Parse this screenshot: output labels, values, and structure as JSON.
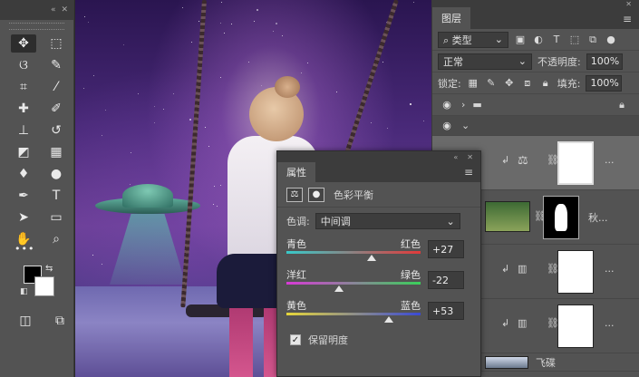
{
  "toolbar": {
    "collapse_label": "«",
    "close_label": "✕",
    "tools": [
      {
        "name": "move-tool",
        "glyph": "✥",
        "active": true
      },
      {
        "name": "marquee-tool",
        "glyph": "⬚",
        "active": false
      },
      {
        "name": "lasso-tool",
        "glyph": "ଓ",
        "active": false
      },
      {
        "name": "quick-select-tool",
        "glyph": "✎",
        "active": false
      },
      {
        "name": "crop-tool",
        "glyph": "⌗",
        "active": false
      },
      {
        "name": "eyedropper-tool",
        "glyph": "⁄",
        "active": false
      },
      {
        "name": "healing-tool",
        "glyph": "✚",
        "active": false
      },
      {
        "name": "brush-tool",
        "glyph": "✐",
        "active": false
      },
      {
        "name": "stamp-tool",
        "glyph": "⊥",
        "active": false
      },
      {
        "name": "history-brush-tool",
        "glyph": "↺",
        "active": false
      },
      {
        "name": "eraser-tool",
        "glyph": "◩",
        "active": false
      },
      {
        "name": "gradient-tool",
        "glyph": "▦",
        "active": false
      },
      {
        "name": "blur-tool",
        "glyph": "♦",
        "active": false
      },
      {
        "name": "dodge-tool",
        "glyph": "●",
        "active": false
      },
      {
        "name": "pen-tool",
        "glyph": "✒",
        "active": false
      },
      {
        "name": "type-tool",
        "glyph": "T",
        "active": false
      },
      {
        "name": "path-select-tool",
        "glyph": "➤",
        "active": false
      },
      {
        "name": "shape-tool",
        "glyph": "▭",
        "active": false
      },
      {
        "name": "hand-tool",
        "glyph": "✋",
        "active": false
      },
      {
        "name": "zoom-tool",
        "glyph": "⌕",
        "active": false
      }
    ],
    "more_label": "•••"
  },
  "layers_panel": {
    "tab_label": "图层",
    "filter_label": "类型",
    "blend_mode": "正常",
    "opacity_label": "不透明度:",
    "opacity_value": "100%",
    "lock_label": "锁定:",
    "fill_label": "填充:",
    "fill_value": "100%",
    "layers": [
      {
        "kind": "group",
        "name": ""
      },
      {
        "kind": "group-open",
        "name": ""
      },
      {
        "kind": "adjustment",
        "name": "..."
      },
      {
        "kind": "photo",
        "name": "秋..."
      },
      {
        "kind": "levels",
        "name": "..."
      },
      {
        "kind": "levels",
        "name": "..."
      },
      {
        "kind": "ufo",
        "name": "飞碟"
      }
    ]
  },
  "properties_panel": {
    "tab_label": "属性",
    "title": "色彩平衡",
    "tone_label": "色调:",
    "tone_value": "中间调",
    "sliders": [
      {
        "left": "青色",
        "right": "红色",
        "value": 27,
        "display": "+27",
        "colors": [
          "#38c9c9",
          "#e23a3a"
        ]
      },
      {
        "left": "洋红",
        "right": "绿色",
        "value": -22,
        "display": "-22",
        "colors": [
          "#d83ad6",
          "#3ad05a"
        ]
      },
      {
        "left": "黄色",
        "right": "蓝色",
        "value": 53,
        "display": "+53",
        "colors": [
          "#e6d63a",
          "#3a4ad6"
        ]
      }
    ],
    "preserve_label": "保留明度",
    "preserve_checked": true
  }
}
